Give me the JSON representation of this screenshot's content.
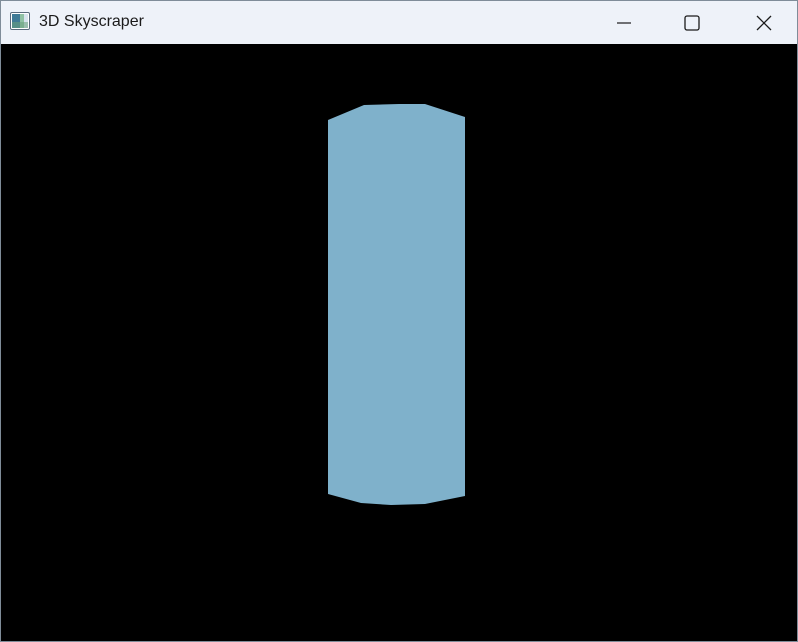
{
  "window": {
    "title": "3D Skyscraper",
    "app_icon": "app-window-icon",
    "controls": {
      "minimize_icon": "minimize-icon",
      "maximize_icon": "maximize-icon",
      "close_icon": "close-icon"
    }
  },
  "scene": {
    "background_color": "#000000",
    "building_color": "#7fb1cb",
    "titlebar_color": "#eef2f9"
  }
}
